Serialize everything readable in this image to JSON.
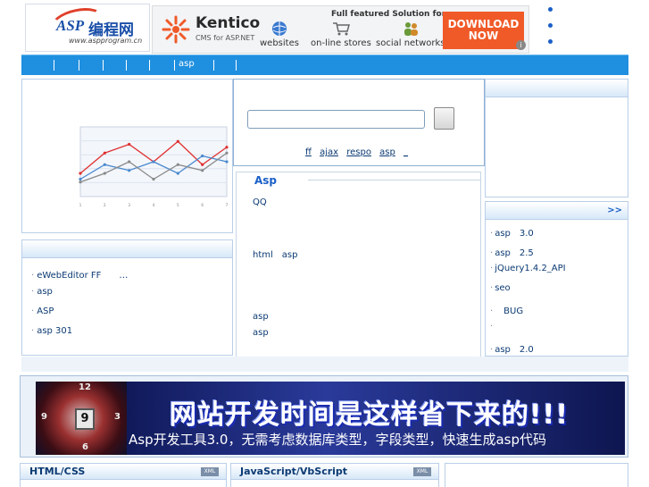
{
  "header": {
    "logo": {
      "main": "ASP",
      "cn": "编程网",
      "url": "www.aspprogram.cn"
    },
    "ad": {
      "brand": "Kentico",
      "tagline": "CMS for ASP.NET",
      "headline": "Full featured Solution for:",
      "features": [
        "websites",
        "on-line stores",
        "social networks"
      ],
      "cta": "DOWNLOAD NOW",
      "info_icon": "info-icon"
    }
  },
  "nav": {
    "items": [
      "asp"
    ]
  },
  "search": {
    "input_value": "",
    "links": [
      "ff",
      "ajax",
      "respo",
      "asp",
      "_"
    ]
  },
  "left_list": {
    "items": [
      "eWebEditor FF　　…",
      "asp",
      "ASP",
      "asp 301"
    ]
  },
  "asp_panel": {
    "title": "Asp",
    "items": [
      "QQ",
      "html　asp",
      "asp",
      "asp"
    ]
  },
  "right_list": {
    "more": ">>",
    "items": [
      "asp　3.0",
      "asp　2.5",
      "jQuery1.4.2_API",
      "seo",
      "　BUG",
      "",
      "asp　2.0"
    ]
  },
  "banner": {
    "title": "网站开发时间是这样省下来的!!!",
    "subtitle": "Asp开发工具3.0，无需考虑数据库类型，字段类型，快速生成asp代码",
    "clock_numbers": [
      "12",
      "9",
      "3",
      "6"
    ],
    "clock_center": "9"
  },
  "bottom_panels": {
    "left_title": "HTML/CSS",
    "middle_title": "JavaScript/VbScript",
    "xml_badge": "XML"
  },
  "chart_data": {
    "type": "line",
    "title": "",
    "xlabel": "",
    "ylabel": "",
    "categories": [
      "1",
      "2",
      "3",
      "4",
      "5",
      "6",
      "7"
    ],
    "series": [
      {
        "name": "",
        "color": "#e03030",
        "values": [
          40,
          75,
          90,
          60,
          95,
          55,
          85
        ]
      },
      {
        "name": "",
        "color": "#4a8ad0",
        "values": [
          30,
          55,
          45,
          60,
          40,
          70,
          60
        ]
      },
      {
        "name": "",
        "color": "#8a8a8a",
        "values": [
          25,
          40,
          60,
          30,
          55,
          45,
          75
        ]
      }
    ],
    "ylim": [
      0,
      120
    ],
    "grid": true
  }
}
